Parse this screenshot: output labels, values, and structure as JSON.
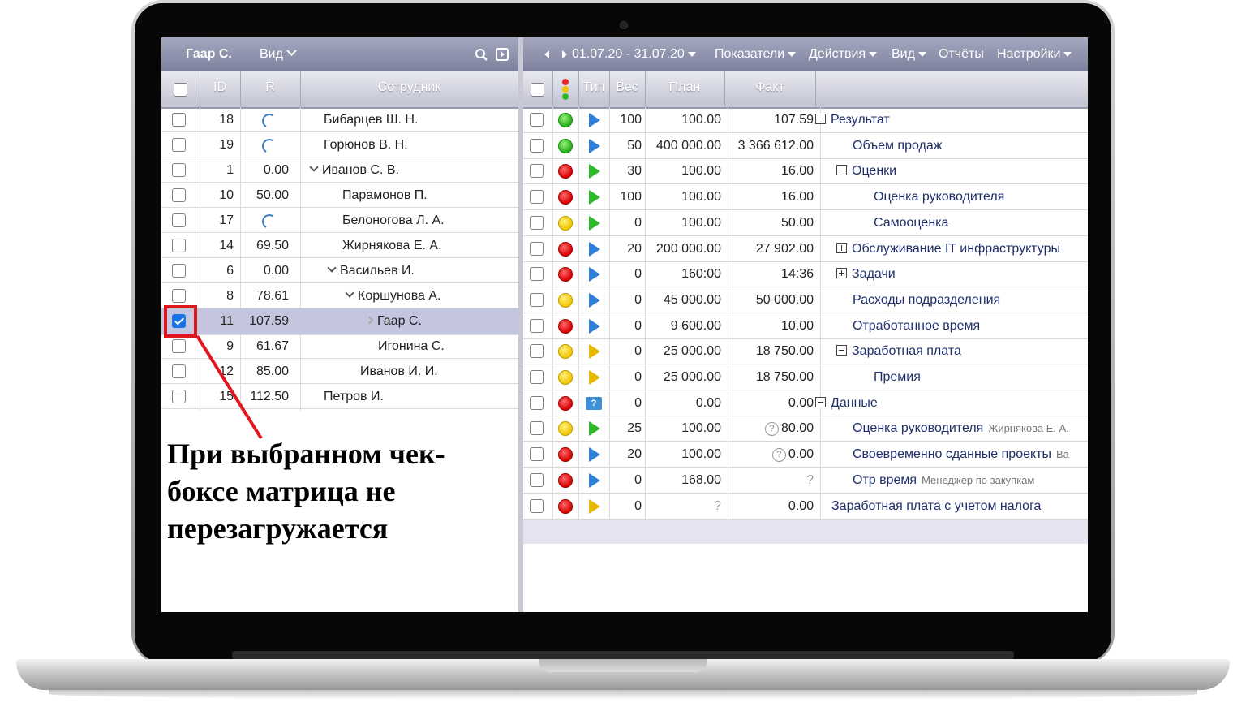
{
  "left_panel": {
    "title": "Гаар С.",
    "view_menu": "Вид",
    "columns": [
      "ID",
      "R",
      "Сотрудник"
    ],
    "rows": [
      {
        "id": "18",
        "r": "",
        "r_loading": true,
        "name": "Бибарцев Ш. Н.",
        "expand": "",
        "checked": false
      },
      {
        "id": "19",
        "r": "",
        "r_loading": true,
        "name": "Горюнов В. Н.",
        "expand": "",
        "checked": false
      },
      {
        "id": "1",
        "r": "0.00",
        "r_loading": false,
        "name": "Иванов С. В.",
        "expand": "down",
        "checked": false
      },
      {
        "id": "10",
        "r": "50.00",
        "r_loading": false,
        "name": "Парамонов П.",
        "expand": "",
        "checked": false
      },
      {
        "id": "17",
        "r": "",
        "r_loading": true,
        "name": "Белоногова Л. А.",
        "expand": "",
        "checked": false
      },
      {
        "id": "14",
        "r": "69.50",
        "r_loading": false,
        "name": "Жирнякова Е. А.",
        "expand": "",
        "checked": false
      },
      {
        "id": "6",
        "r": "0.00",
        "r_loading": false,
        "name": "Васильев И.",
        "expand": "down",
        "checked": false
      },
      {
        "id": "8",
        "r": "78.61",
        "r_loading": false,
        "name": "Коршунова А.",
        "expand": "down",
        "checked": false
      },
      {
        "id": "11",
        "r": "107.59",
        "r_loading": false,
        "name": "Гаар С.",
        "expand": "right",
        "checked": true
      },
      {
        "id": "9",
        "r": "61.67",
        "r_loading": false,
        "name": "Игонина С.",
        "expand": "",
        "checked": false
      },
      {
        "id": "12",
        "r": "85.00",
        "r_loading": false,
        "name": "Иванов И. И.",
        "expand": "",
        "checked": false
      },
      {
        "id": "15",
        "r": "112.50",
        "r_loading": false,
        "name": "Петров И.",
        "expand": "",
        "checked": false
      }
    ]
  },
  "right_panel": {
    "period": "01.07.20 - 31.07.20",
    "menus": [
      "Показатели",
      "Действия",
      "Вид",
      "Отчёты",
      "Настройки"
    ],
    "columns": {
      "type": "Тип",
      "weight": "Вес",
      "plan": "План",
      "fact": "Факт"
    },
    "rows": [
      {
        "status": "green",
        "type": "blue",
        "weight": "100",
        "plan": "100.00",
        "fact": "107.59",
        "name": "Результат",
        "toggle": "minus",
        "level": 0,
        "note": "",
        "fact_q": false
      },
      {
        "status": "green",
        "type": "blue",
        "weight": "50",
        "plan": "400 000.00",
        "fact": "3 366 612.00",
        "name": "Объем продаж",
        "toggle": "",
        "level": 1,
        "note": "",
        "fact_q": false
      },
      {
        "status": "red",
        "type": "green",
        "weight": "30",
        "plan": "100.00",
        "fact": "16.00",
        "name": "Оценки",
        "toggle": "minus",
        "level": 1,
        "note": "",
        "fact_q": false
      },
      {
        "status": "red",
        "type": "green",
        "weight": "100",
        "plan": "100.00",
        "fact": "16.00",
        "name": "Оценка руководителя",
        "toggle": "",
        "level": 2,
        "note": "",
        "fact_q": false
      },
      {
        "status": "yellow",
        "type": "green",
        "weight": "0",
        "plan": "100.00",
        "fact": "50.00",
        "name": "Самооценка",
        "toggle": "",
        "level": 2,
        "note": "",
        "fact_q": false
      },
      {
        "status": "red",
        "type": "blue",
        "weight": "20",
        "plan": "200 000.00",
        "fact": "27 902.00",
        "name": "Обслуживание IT инфраструктуры",
        "toggle": "plus",
        "level": 1,
        "note": "",
        "fact_q": false
      },
      {
        "status": "red",
        "type": "blue",
        "weight": "0",
        "plan": "160:00",
        "fact": "14:36",
        "name": "Задачи",
        "toggle": "plus",
        "level": 1,
        "note": "",
        "fact_q": false
      },
      {
        "status": "yellow",
        "type": "blue",
        "weight": "0",
        "plan": "45 000.00",
        "fact": "50 000.00",
        "name": "Расходы подразделения",
        "toggle": "",
        "level": 1,
        "note": "",
        "fact_q": false
      },
      {
        "status": "red",
        "type": "blue",
        "weight": "0",
        "plan": "9 600.00",
        "fact": "10.00",
        "name": "Отработанное время",
        "toggle": "",
        "level": 1,
        "note": "",
        "fact_q": false
      },
      {
        "status": "yellow",
        "type": "yellow",
        "weight": "0",
        "plan": "25 000.00",
        "fact": "18 750.00",
        "name": "Заработная плата",
        "toggle": "minus",
        "level": 1,
        "note": "",
        "fact_q": false
      },
      {
        "status": "yellow",
        "type": "yellow",
        "weight": "0",
        "plan": "25 000.00",
        "fact": "18 750.00",
        "name": "Премия",
        "toggle": "",
        "level": 2,
        "note": "",
        "fact_q": false
      },
      {
        "status": "red",
        "type": "question",
        "weight": "0",
        "plan": "0.00",
        "fact": "0.00",
        "name": "Данные",
        "toggle": "minus",
        "level": 0,
        "note": "",
        "fact_q": false
      },
      {
        "status": "yellow",
        "type": "green",
        "weight": "25",
        "plan": "100.00",
        "fact": "80.00",
        "name": "Оценка руководителя",
        "toggle": "",
        "level": 1,
        "note": "Жирнякова Е. А.",
        "fact_q": true
      },
      {
        "status": "red",
        "type": "blue",
        "weight": "20",
        "plan": "100.00",
        "fact": "0.00",
        "name": "Своевременно сданные проекты",
        "toggle": "",
        "level": 1,
        "note": "Ва",
        "fact_q": true
      },
      {
        "status": "red",
        "type": "blue",
        "weight": "0",
        "plan": "168.00",
        "fact": "?",
        "name": "Отр время",
        "toggle": "",
        "level": 1,
        "note": "Менеджер по закупкам",
        "fact_q": false
      },
      {
        "status": "red",
        "type": "yellow",
        "weight": "0",
        "plan": "?",
        "fact": "0.00",
        "name": "Заработная плата с учетом налога",
        "toggle": "",
        "level": 0,
        "note": "",
        "fact_q": false
      }
    ]
  },
  "annotation": {
    "text": "При выбранном чек-боксе матрица не перезагружается",
    "color": "#e0161e"
  },
  "colors": {
    "header": "#8f93ad",
    "selected_row": "#c4c5df",
    "link_text": "#1f2f6b"
  }
}
